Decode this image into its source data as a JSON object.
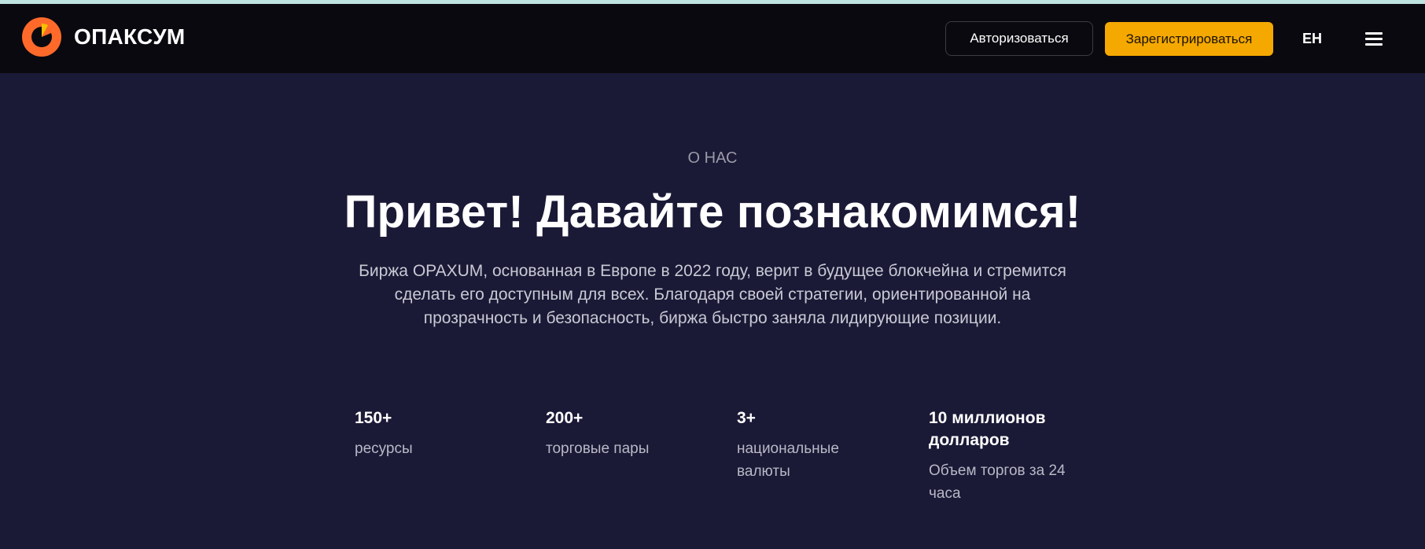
{
  "header": {
    "brand_name": "ОПАКСУМ",
    "login_label": "Авторизоваться",
    "register_label": "Зарегистрироваться",
    "language": "EH",
    "menu_icon": "hamburger-menu-icon",
    "colors": {
      "header_bg": "#0a090f",
      "accent": "#f5a800",
      "logo_orange": "#ff6a2a"
    }
  },
  "about": {
    "section_label": "О НАС",
    "title": "Привет! Давайте познакомимся!",
    "description": "Биржа OPAXUM, основанная в Европе в 2022 году, верит в будущее блокчейна и стремится сделать его доступным для всех. Благодаря своей стратегии, ориентированной на прозрачность и безопасность, биржа быстро заняла лидирующие позиции.",
    "background": "#1a1a37"
  },
  "stats": [
    {
      "value": "150+",
      "label": "ресурсы"
    },
    {
      "value": "200+",
      "label": "торговые пары"
    },
    {
      "value": "3+",
      "label": "национальные валюты"
    },
    {
      "value": "10 миллионов долларов",
      "label": "Объем торгов за 24 часа"
    }
  ]
}
